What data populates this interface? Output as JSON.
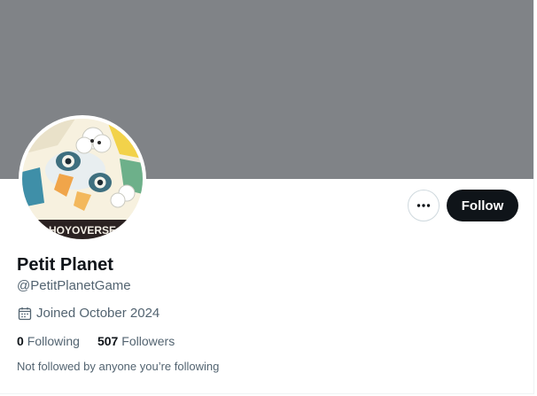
{
  "profile": {
    "display_name": "Petit Planet",
    "handle": "@PetitPlanetGame",
    "joined": "Joined October 2024",
    "following_count": "0",
    "following_label": "Following",
    "followers_count": "507",
    "followers_label": "Followers",
    "not_followed_note": "Not followed by anyone you’re following",
    "avatar_watermark": "HOYOVERSE"
  },
  "actions": {
    "follow_label": "Follow",
    "more_icon": "more-horizontal-icon"
  },
  "icons": {
    "calendar": "calendar-icon"
  },
  "colors": {
    "banner": "#808387",
    "follow_button_bg": "#0f1419",
    "secondary_text": "#536471"
  }
}
